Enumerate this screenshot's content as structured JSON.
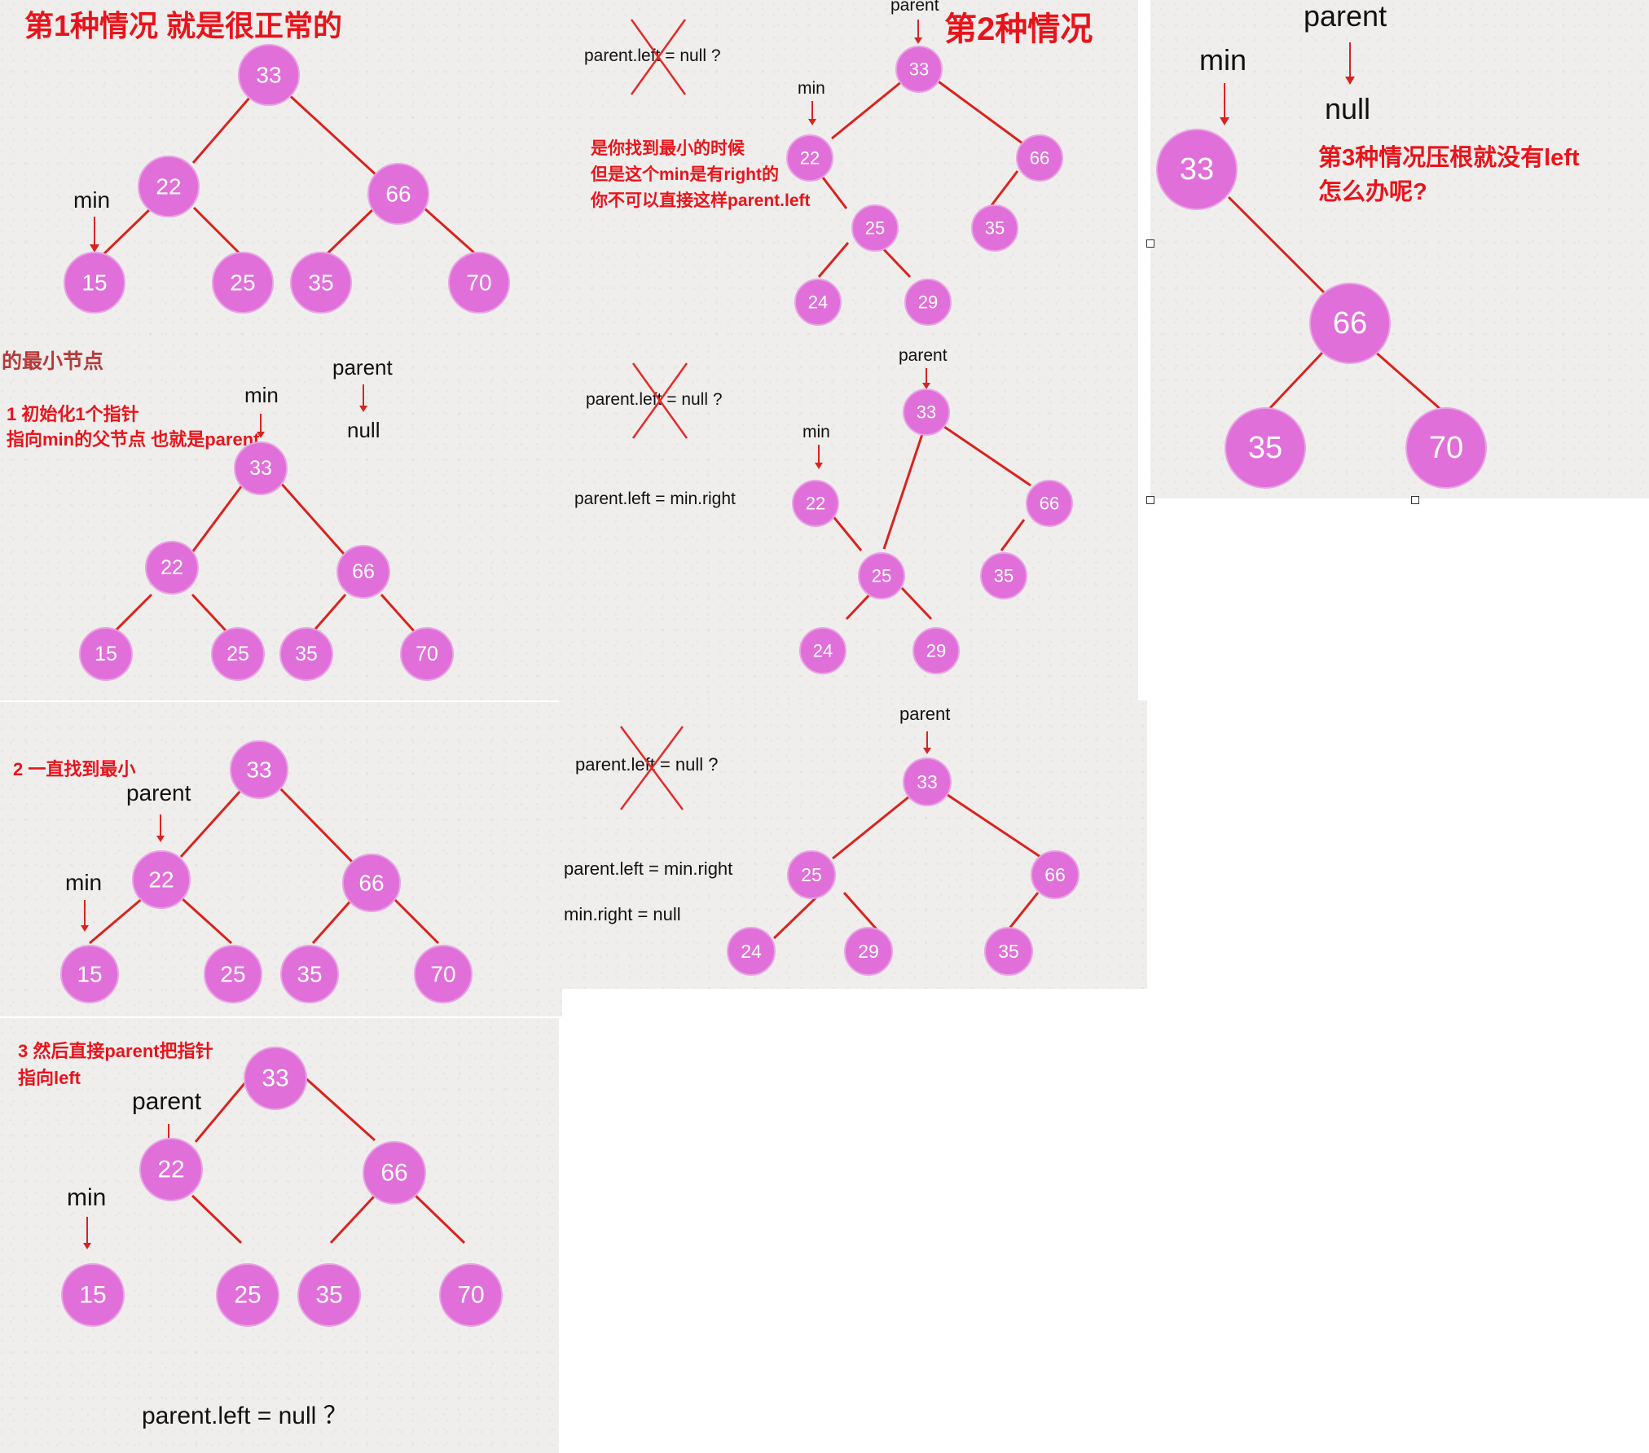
{
  "titles": {
    "case1": "第1种情况 就是很正常的",
    "case2": "第2种情况",
    "case3": "第3种情况压根就没有left",
    "case3_line2": "怎么办呢?"
  },
  "labels": {
    "min": "min",
    "parent": "parent",
    "null": "null"
  },
  "notes": {
    "min_node": "的最小节点",
    "step1_line1": "1 初始化1个指针",
    "step1_line2": "指向min的父节点 也就是parent",
    "step2": "2 一直找到最小",
    "step3_line1": "3 然后直接parent把指针",
    "step3_line2": "指向left",
    "case2_line1": "是你找到最小的时候",
    "case2_line2": "但是这个min是有right的",
    "case2_line3": "你不可以直接这样parent.left"
  },
  "code": {
    "left_null_q": "parent.left = null ?",
    "left_null_q_sp": "parent.left = null ？",
    "left_eq_min_right": "parent.left = min.right",
    "min_right_null": "min.right = null"
  },
  "nodes": {
    "n33": "33",
    "n22": "22",
    "n66": "66",
    "n15": "15",
    "n25": "25",
    "n35": "35",
    "n70": "70",
    "n24": "24",
    "n29": "29"
  },
  "colors": {
    "node_fill": "#e06fd9",
    "edge": "#d9231f",
    "title_red": "#e8141b"
  }
}
